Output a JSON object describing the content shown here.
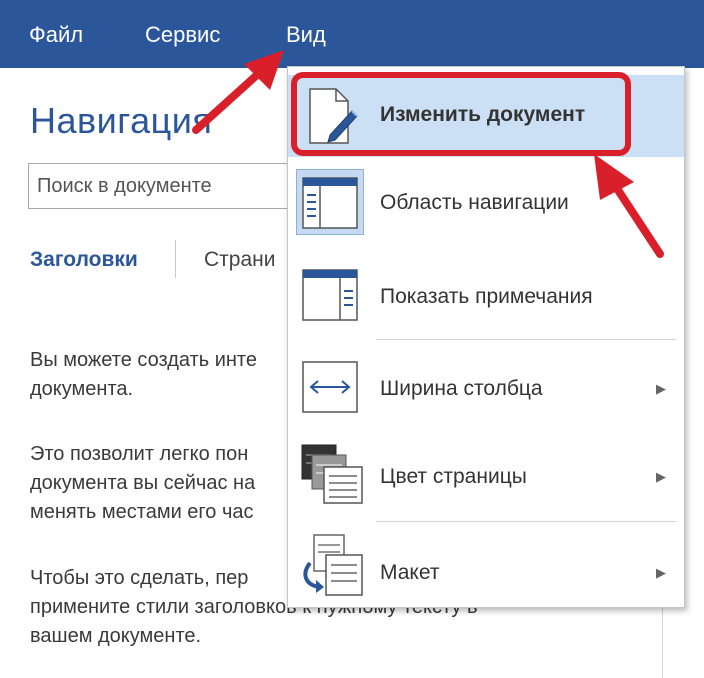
{
  "menubar": {
    "items": [
      "Файл",
      "Сервис",
      "Вид"
    ]
  },
  "nav_pane": {
    "title": "Навигация",
    "search_placeholder": "Поиск в документе",
    "tabs": [
      "Заголовки",
      "Страни"
    ],
    "paragraphs": [
      "Вы можете создать инте",
      "документа.",
      "Это позволит легко пон",
      "документа вы сейчас на",
      "менять местами его час",
      "Чтобы это сделать, пер",
      "примените стили заголовков к нужному тексту в",
      "вашем документе."
    ]
  },
  "view_menu": {
    "items": [
      {
        "label": "Изменить документ",
        "icon": "edit-document-icon",
        "has_submenu": false
      },
      {
        "label": "Область навигации",
        "icon": "navigation-pane-icon",
        "has_submenu": false
      },
      {
        "label": "Показать примечания",
        "icon": "show-comments-icon",
        "has_submenu": false
      },
      {
        "label": "Ширина столбца",
        "icon": "column-width-icon",
        "has_submenu": true
      },
      {
        "label": "Цвет страницы",
        "icon": "page-color-icon",
        "has_submenu": true
      },
      {
        "label": "Макет",
        "icon": "layout-icon",
        "has_submenu": true
      }
    ]
  },
  "colors": {
    "menubar": "#2b579a",
    "highlight": "#cbe0f4",
    "annotation_red": "#d9202a"
  }
}
